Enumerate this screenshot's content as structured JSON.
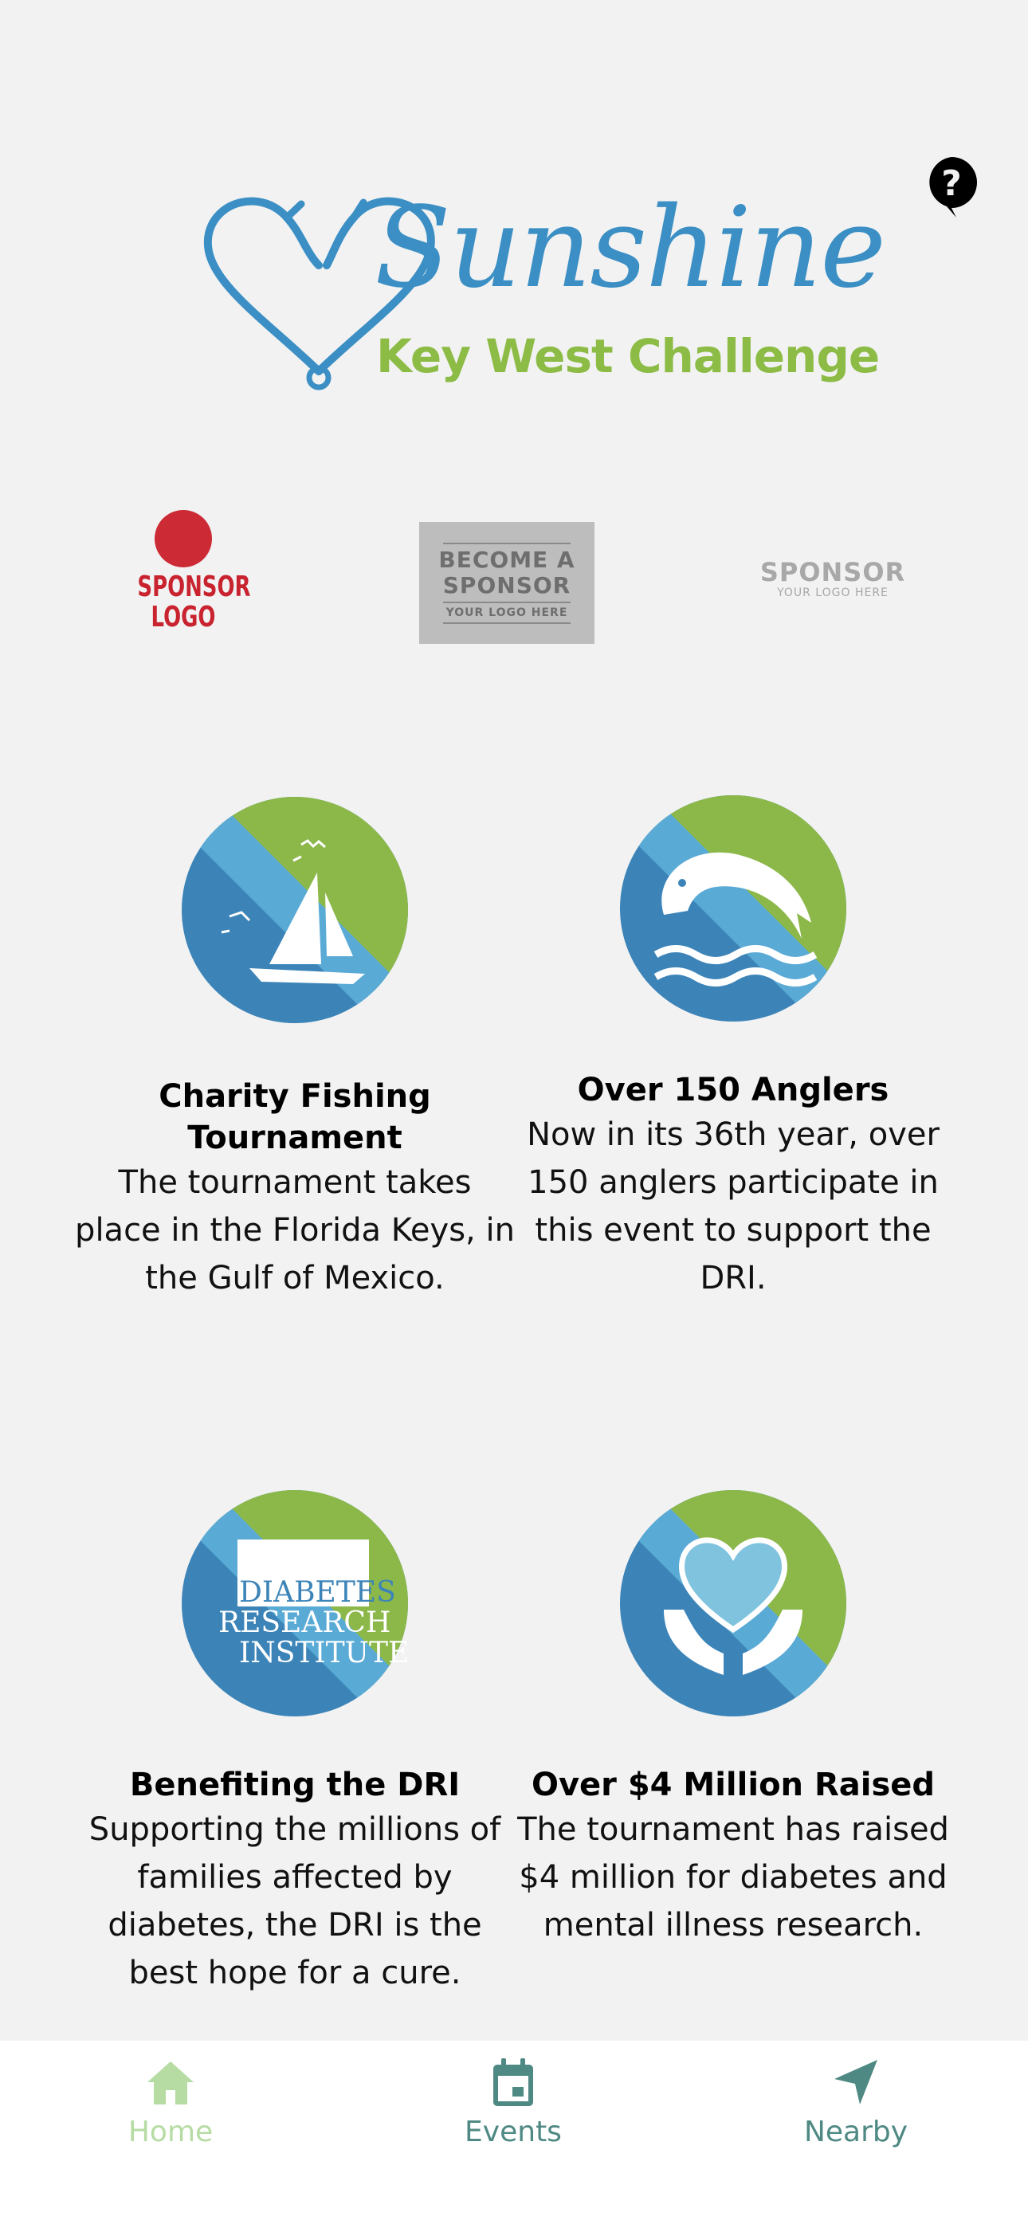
{
  "header": {
    "brand_title": "Sunshine",
    "brand_subtitle": "Key West Challenge",
    "help_icon": "question-bubble-icon"
  },
  "sponsors": [
    {
      "line1": "SPONSOR",
      "line2": "LOGO"
    },
    {
      "line1": "BECOME A",
      "line2": "SPONSOR",
      "line3": "YOUR LOGO HERE"
    },
    {
      "line1": "SPONSOR",
      "line2": "YOUR LOGO HERE"
    }
  ],
  "features": [
    {
      "title": "Charity Fishing Tournament",
      "description": "The tournament takes place in the Florida Keys, in the Gulf of Mexico.",
      "icon": "sailboat-icon"
    },
    {
      "title": "Over 150 Anglers",
      "description": "Now in its 36th year, over 150 anglers participate in this event to support the DRI.",
      "icon": "fish-icon"
    },
    {
      "title": "Benefiting the DRI",
      "description": "Supporting the millions of families affected by diabetes, the DRI is the best hope for a cure.",
      "icon": "dri-logo-icon",
      "logo_text": [
        "DIABETES",
        "RESEARCH",
        "INSTITUTE"
      ]
    },
    {
      "title": "Over $4 Million Raised",
      "description": "The tournament has raised $4 million for diabetes and mental illness research.",
      "icon": "heart-hands-icon"
    }
  ],
  "tabbar": {
    "items": [
      {
        "label": "Home",
        "icon": "home-icon",
        "active": true
      },
      {
        "label": "Events",
        "icon": "calendar-icon",
        "active": false
      },
      {
        "label": "Nearby",
        "icon": "location-arrow-icon",
        "active": false
      }
    ]
  },
  "colors": {
    "background": "#f2f2f2",
    "brand_blue": "#3b8fc4",
    "brand_green": "#8cbc45",
    "tab_active": "#b6dca4",
    "tab_inactive": "#4f8983"
  }
}
